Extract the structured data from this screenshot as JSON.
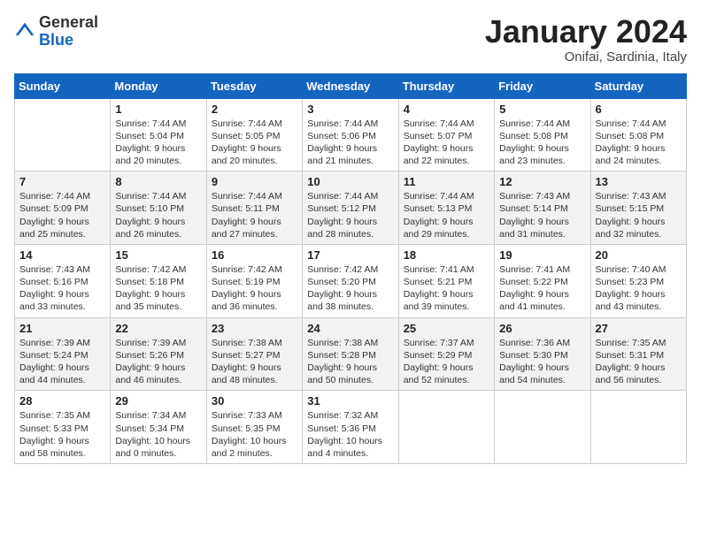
{
  "header": {
    "logo_general": "General",
    "logo_blue": "Blue",
    "month_title": "January 2024",
    "subtitle": "Onifai, Sardinia, Italy"
  },
  "days_of_week": [
    "Sunday",
    "Monday",
    "Tuesday",
    "Wednesday",
    "Thursday",
    "Friday",
    "Saturday"
  ],
  "weeks": [
    [
      {
        "day": "",
        "info": ""
      },
      {
        "day": "1",
        "info": "Sunrise: 7:44 AM\nSunset: 5:04 PM\nDaylight: 9 hours and 20 minutes."
      },
      {
        "day": "2",
        "info": "Sunrise: 7:44 AM\nSunset: 5:05 PM\nDaylight: 9 hours and 20 minutes."
      },
      {
        "day": "3",
        "info": "Sunrise: 7:44 AM\nSunset: 5:06 PM\nDaylight: 9 hours and 21 minutes."
      },
      {
        "day": "4",
        "info": "Sunrise: 7:44 AM\nSunset: 5:07 PM\nDaylight: 9 hours and 22 minutes."
      },
      {
        "day": "5",
        "info": "Sunrise: 7:44 AM\nSunset: 5:08 PM\nDaylight: 9 hours and 23 minutes."
      },
      {
        "day": "6",
        "info": "Sunrise: 7:44 AM\nSunset: 5:08 PM\nDaylight: 9 hours and 24 minutes."
      }
    ],
    [
      {
        "day": "7",
        "info": "Sunrise: 7:44 AM\nSunset: 5:09 PM\nDaylight: 9 hours and 25 minutes."
      },
      {
        "day": "8",
        "info": "Sunrise: 7:44 AM\nSunset: 5:10 PM\nDaylight: 9 hours and 26 minutes."
      },
      {
        "day": "9",
        "info": "Sunrise: 7:44 AM\nSunset: 5:11 PM\nDaylight: 9 hours and 27 minutes."
      },
      {
        "day": "10",
        "info": "Sunrise: 7:44 AM\nSunset: 5:12 PM\nDaylight: 9 hours and 28 minutes."
      },
      {
        "day": "11",
        "info": "Sunrise: 7:44 AM\nSunset: 5:13 PM\nDaylight: 9 hours and 29 minutes."
      },
      {
        "day": "12",
        "info": "Sunrise: 7:43 AM\nSunset: 5:14 PM\nDaylight: 9 hours and 31 minutes."
      },
      {
        "day": "13",
        "info": "Sunrise: 7:43 AM\nSunset: 5:15 PM\nDaylight: 9 hours and 32 minutes."
      }
    ],
    [
      {
        "day": "14",
        "info": "Sunrise: 7:43 AM\nSunset: 5:16 PM\nDaylight: 9 hours and 33 minutes."
      },
      {
        "day": "15",
        "info": "Sunrise: 7:42 AM\nSunset: 5:18 PM\nDaylight: 9 hours and 35 minutes."
      },
      {
        "day": "16",
        "info": "Sunrise: 7:42 AM\nSunset: 5:19 PM\nDaylight: 9 hours and 36 minutes."
      },
      {
        "day": "17",
        "info": "Sunrise: 7:42 AM\nSunset: 5:20 PM\nDaylight: 9 hours and 38 minutes."
      },
      {
        "day": "18",
        "info": "Sunrise: 7:41 AM\nSunset: 5:21 PM\nDaylight: 9 hours and 39 minutes."
      },
      {
        "day": "19",
        "info": "Sunrise: 7:41 AM\nSunset: 5:22 PM\nDaylight: 9 hours and 41 minutes."
      },
      {
        "day": "20",
        "info": "Sunrise: 7:40 AM\nSunset: 5:23 PM\nDaylight: 9 hours and 43 minutes."
      }
    ],
    [
      {
        "day": "21",
        "info": "Sunrise: 7:39 AM\nSunset: 5:24 PM\nDaylight: 9 hours and 44 minutes."
      },
      {
        "day": "22",
        "info": "Sunrise: 7:39 AM\nSunset: 5:26 PM\nDaylight: 9 hours and 46 minutes."
      },
      {
        "day": "23",
        "info": "Sunrise: 7:38 AM\nSunset: 5:27 PM\nDaylight: 9 hours and 48 minutes."
      },
      {
        "day": "24",
        "info": "Sunrise: 7:38 AM\nSunset: 5:28 PM\nDaylight: 9 hours and 50 minutes."
      },
      {
        "day": "25",
        "info": "Sunrise: 7:37 AM\nSunset: 5:29 PM\nDaylight: 9 hours and 52 minutes."
      },
      {
        "day": "26",
        "info": "Sunrise: 7:36 AM\nSunset: 5:30 PM\nDaylight: 9 hours and 54 minutes."
      },
      {
        "day": "27",
        "info": "Sunrise: 7:35 AM\nSunset: 5:31 PM\nDaylight: 9 hours and 56 minutes."
      }
    ],
    [
      {
        "day": "28",
        "info": "Sunrise: 7:35 AM\nSunset: 5:33 PM\nDaylight: 9 hours and 58 minutes."
      },
      {
        "day": "29",
        "info": "Sunrise: 7:34 AM\nSunset: 5:34 PM\nDaylight: 10 hours and 0 minutes."
      },
      {
        "day": "30",
        "info": "Sunrise: 7:33 AM\nSunset: 5:35 PM\nDaylight: 10 hours and 2 minutes."
      },
      {
        "day": "31",
        "info": "Sunrise: 7:32 AM\nSunset: 5:36 PM\nDaylight: 10 hours and 4 minutes."
      },
      {
        "day": "",
        "info": ""
      },
      {
        "day": "",
        "info": ""
      },
      {
        "day": "",
        "info": ""
      }
    ]
  ]
}
